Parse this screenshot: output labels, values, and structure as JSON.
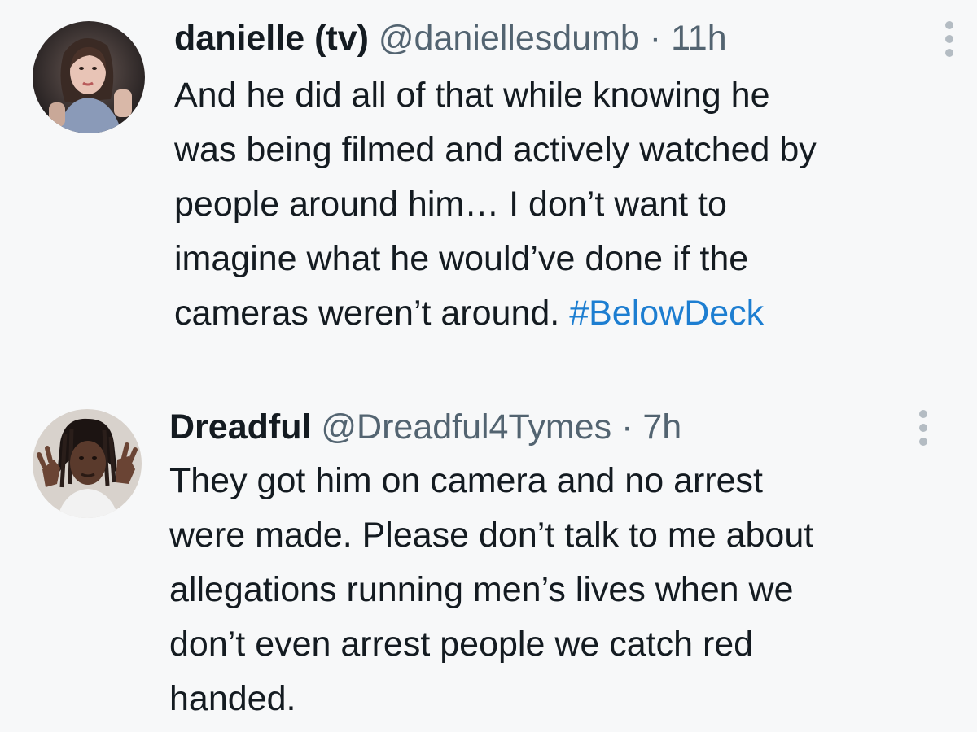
{
  "tweets": [
    {
      "display_name": "danielle (tv)",
      "handle": "@daniellesdumb",
      "separator": "·",
      "time": "11h",
      "avatar_icon": "avatar-woman-portrait",
      "lines": [
        "And he did all of that while knowing he",
        "was being filmed and actively watched by",
        "people around him… I don’t want to",
        "imagine what he would’ve done if the"
      ],
      "last_line_text": "cameras weren’t around. ",
      "hashtag": "#BelowDeck"
    },
    {
      "display_name": "Dreadful",
      "handle": "@Dreadful4Tymes",
      "separator": "·",
      "time": "7h",
      "avatar_icon": "avatar-man-hand-sign",
      "lines": [
        "They got him on camera and no arrest",
        "were made. Please don’t talk to me about",
        "allegations running men’s lives when we",
        "don’t even arrest people we catch red",
        "handed."
      ]
    }
  ],
  "colors": {
    "background": "#f7f8f9",
    "text": "#141b21",
    "secondary_text": "#536471",
    "hashtag": "#1d7ed1",
    "more_dots": "#b4bcc3"
  }
}
